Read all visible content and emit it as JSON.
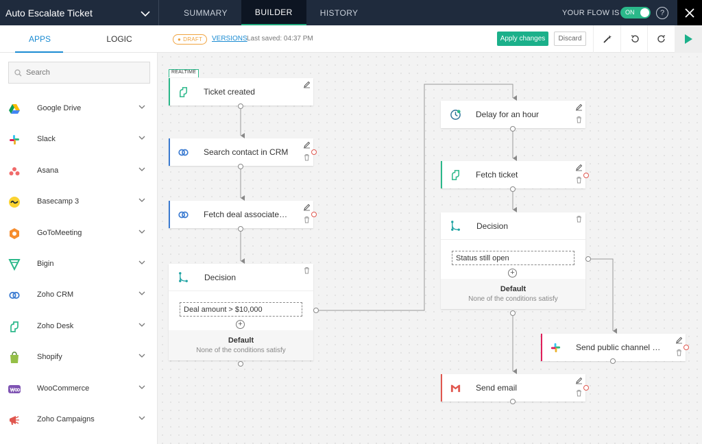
{
  "header": {
    "flow_title": "Auto Escalate Ticket",
    "tabs": [
      {
        "label": "SUMMARY"
      },
      {
        "label": "BUILDER"
      },
      {
        "label": "HISTORY"
      }
    ],
    "flow_status_label": "YOUR FLOW IS",
    "flow_toggle": "ON",
    "help": "?"
  },
  "sidebar": {
    "tabs": [
      {
        "label": "APPS"
      },
      {
        "label": "LOGIC"
      }
    ],
    "search_placeholder": "Search",
    "apps": [
      {
        "name": "Google Drive",
        "icon": "google-drive-icon"
      },
      {
        "name": "Slack",
        "icon": "slack-icon"
      },
      {
        "name": "Asana",
        "icon": "asana-icon"
      },
      {
        "name": "Basecamp 3",
        "icon": "basecamp-icon"
      },
      {
        "name": "GoToMeeting",
        "icon": "gotomeeting-icon"
      },
      {
        "name": "Bigin",
        "icon": "bigin-icon"
      },
      {
        "name": "Zoho CRM",
        "icon": "zoho-crm-icon"
      },
      {
        "name": "Zoho Desk",
        "icon": "zoho-desk-icon"
      },
      {
        "name": "Shopify",
        "icon": "shopify-icon"
      },
      {
        "name": "WooCommerce",
        "icon": "woocommerce-icon"
      },
      {
        "name": "Zoho Campaigns",
        "icon": "zoho-campaigns-icon"
      }
    ]
  },
  "toolbar": {
    "draft": "DRAFT",
    "versions": "VERSIONS",
    "last_saved": "Last saved: 04:37 PM",
    "apply": "Apply changes",
    "discard": "Discard"
  },
  "canvas": {
    "realtime_badge": "REALTIME",
    "nodes": {
      "ticket_created": "Ticket created",
      "search_contact": "Search contact in CRM",
      "fetch_deal": "Fetch deal associated ...",
      "decision_1": "Decision",
      "decision_1_condition": "Deal amount > $10,000",
      "decision_1_default_title": "Default",
      "decision_1_default_sub": "None of the conditions satisfy",
      "delay": "Delay for an hour",
      "fetch_ticket": "Fetch ticket",
      "decision_2": "Decision",
      "decision_2_condition": "Status still open",
      "decision_2_default_title": "Default",
      "decision_2_default_sub": "None of the conditions satisfy",
      "send_slack": "Send public channel m...",
      "send_email": "Send email"
    }
  },
  "colors": {
    "header_bg": "#1f2b3d",
    "accent_green": "#1bb08a",
    "accent_blue": "#1a8bd2",
    "desk_green": "#2bb88a",
    "crm_blue": "#3b7bd1",
    "gmail_red": "#e0574f"
  }
}
